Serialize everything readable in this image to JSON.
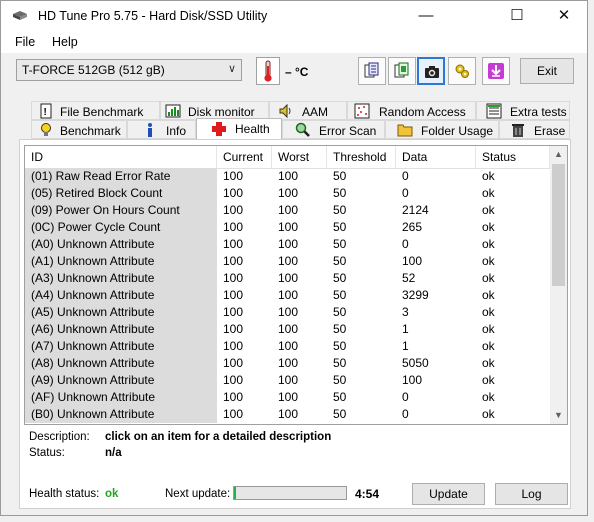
{
  "window": {
    "title": "HD Tune Pro 5.75 - Hard Disk/SSD Utility"
  },
  "menu": [
    "File",
    "Help"
  ],
  "toolbar": {
    "drive": "T-FORCE 512GB (512 gB)",
    "temperature": "– °C",
    "exit_label": "Exit"
  },
  "tabs_top": [
    "File Benchmark",
    "Disk monitor",
    "AAM",
    "Random Access",
    "Extra tests"
  ],
  "tabs_bottom": [
    "Benchmark",
    "Info",
    "Health",
    "Error Scan",
    "Folder Usage",
    "Erase"
  ],
  "active_tab": "Health",
  "table": {
    "headers": [
      "ID",
      "Current",
      "Worst",
      "Threshold",
      "Data",
      "Status"
    ],
    "rows": [
      [
        "(01) Raw Read Error Rate",
        "100",
        "100",
        "50",
        "0",
        "ok"
      ],
      [
        "(05) Retired Block Count",
        "100",
        "100",
        "50",
        "0",
        "ok"
      ],
      [
        "(09) Power On Hours Count",
        "100",
        "100",
        "50",
        "2124",
        "ok"
      ],
      [
        "(0C) Power Cycle Count",
        "100",
        "100",
        "50",
        "265",
        "ok"
      ],
      [
        "(A0) Unknown Attribute",
        "100",
        "100",
        "50",
        "0",
        "ok"
      ],
      [
        "(A1) Unknown Attribute",
        "100",
        "100",
        "50",
        "100",
        "ok"
      ],
      [
        "(A3) Unknown Attribute",
        "100",
        "100",
        "50",
        "52",
        "ok"
      ],
      [
        "(A4) Unknown Attribute",
        "100",
        "100",
        "50",
        "3299",
        "ok"
      ],
      [
        "(A5) Unknown Attribute",
        "100",
        "100",
        "50",
        "3",
        "ok"
      ],
      [
        "(A6) Unknown Attribute",
        "100",
        "100",
        "50",
        "1",
        "ok"
      ],
      [
        "(A7) Unknown Attribute",
        "100",
        "100",
        "50",
        "1",
        "ok"
      ],
      [
        "(A8) Unknown Attribute",
        "100",
        "100",
        "50",
        "5050",
        "ok"
      ],
      [
        "(A9) Unknown Attribute",
        "100",
        "100",
        "50",
        "100",
        "ok"
      ],
      [
        "(AF) Unknown Attribute",
        "100",
        "100",
        "50",
        "0",
        "ok"
      ],
      [
        "(B0) Unknown Attribute",
        "100",
        "100",
        "50",
        "0",
        "ok"
      ]
    ]
  },
  "details": {
    "description_label": "Description:",
    "description_value": "click on an item for a detailed description",
    "status_label": "Status:",
    "status_value": "n/a"
  },
  "footer": {
    "health_label": "Health status:",
    "health_value": "ok",
    "next_update_label": "Next update:",
    "countdown": "4:54",
    "progress_fraction": 0.02,
    "update_label": "Update",
    "log_label": "Log"
  },
  "colors": {
    "health_ok": "#22a522",
    "progress": "#23b14d",
    "accent": "#2b79d6"
  },
  "icons": [
    "hdtune-app-icon",
    "minimize-icon",
    "maximize-icon",
    "close-icon",
    "thermometer-icon",
    "copy-text-icon",
    "copy-info-icon",
    "camera-icon",
    "settings-icon",
    "save-down-icon"
  ]
}
